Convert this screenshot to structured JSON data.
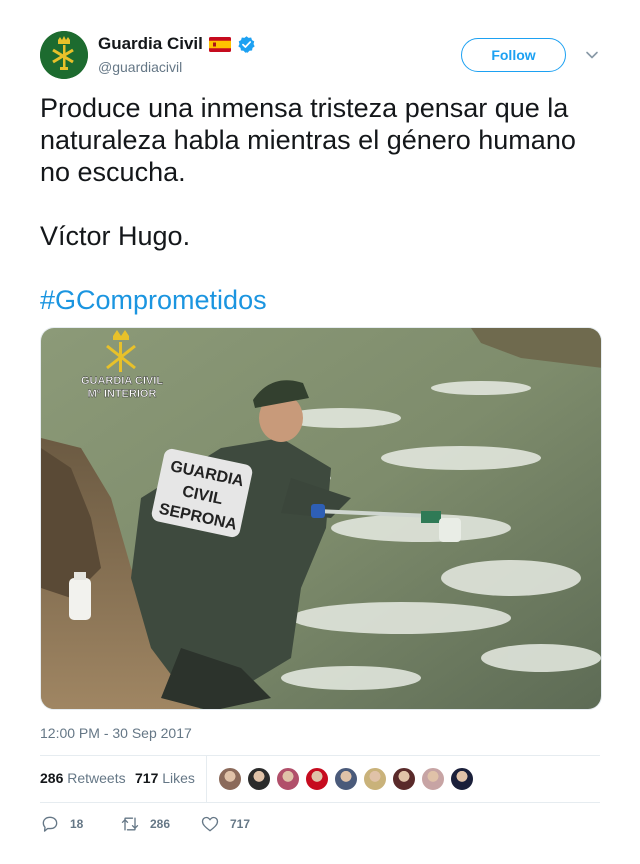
{
  "account": {
    "display_name": "Guardia Civil",
    "handle": "@guardiacivil",
    "verified": true,
    "flag_icon": "spain-flag-icon",
    "avatar_icon": "guardia-civil-emblem-icon"
  },
  "follow_button": {
    "label": "Follow"
  },
  "menu": {
    "icon": "chevron-down-icon"
  },
  "tweet": {
    "lines": [
      "Produce una inmensa tristeza pensar que la",
      "naturaleza habla mientras el género humano",
      "no escucha.",
      "Víctor Hugo."
    ],
    "hashtag": "#GComprometidos"
  },
  "media": {
    "watermark_line1": "GUARDIA CIVIL",
    "watermark_line2": "Mº INTERIOR",
    "jacket_text": [
      "GUARDIA",
      "CIVIL",
      "SEPRONA"
    ]
  },
  "timestamp": "12:00 PM - 30 Sep 2017",
  "stats": {
    "retweets_count": "286",
    "retweets_label": "Retweets",
    "likes_count": "717",
    "likes_label": "Likes"
  },
  "likers": [
    {
      "name": "liker-avatar-1",
      "color": "#8b6a5a"
    },
    {
      "name": "liker-avatar-2",
      "color": "#2b2b2b"
    },
    {
      "name": "liker-avatar-3",
      "color": "#b14f6a"
    },
    {
      "name": "liker-avatar-4",
      "color": "#c60b1e"
    },
    {
      "name": "liker-avatar-5",
      "color": "#4a5a7a"
    },
    {
      "name": "liker-avatar-6",
      "color": "#c9b27a"
    },
    {
      "name": "liker-avatar-7",
      "color": "#5a2a2a"
    },
    {
      "name": "liker-avatar-8",
      "color": "#c7a4a4"
    },
    {
      "name": "liker-avatar-9",
      "color": "#1a1f3a"
    }
  ],
  "actions": {
    "reply_count": "18",
    "retweet_count": "286",
    "like_count": "717"
  },
  "colors": {
    "accent": "#1da1f2",
    "hashtag": "#1b95e0",
    "secondary_text": "#657786",
    "verified": "#1da1f2"
  }
}
